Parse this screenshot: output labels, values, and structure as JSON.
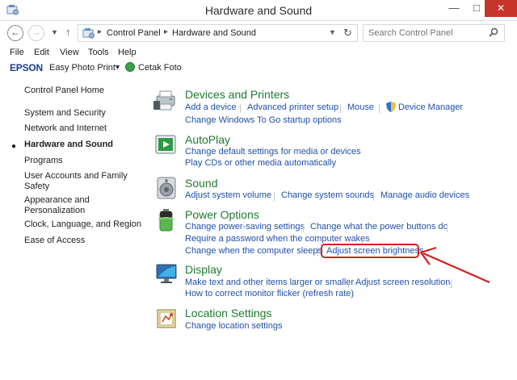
{
  "window": {
    "title": "Hardware and Sound",
    "minimize_glyph": "—",
    "maximize_glyph": "□",
    "close_glyph": "✕"
  },
  "address": {
    "breadcrumb": [
      "Control Panel",
      "Hardware and Sound"
    ],
    "search_placeholder": "Search Control Panel"
  },
  "menubar": {
    "items": [
      "File",
      "Edit",
      "View",
      "Tools",
      "Help"
    ]
  },
  "toolbar": {
    "brand": "EPSON",
    "app_label": "Easy Photo Print",
    "cetak_label": "Cetak Foto"
  },
  "sidebar": {
    "home": "Control Panel Home",
    "items": [
      "System and Security",
      "Network and Internet",
      "Hardware and Sound",
      "Programs",
      "User Accounts and Family",
      "Safety",
      "Appearance and",
      "Personalization",
      "Clock, Language, and Region",
      "Ease of Access"
    ],
    "active": "Hardware and Sound"
  },
  "categories": {
    "devices": {
      "title": "Devices and Printers",
      "links": [
        "Add a device",
        "Advanced printer setup",
        "Mouse",
        "Device Manager",
        "Change Windows To Go startup options"
      ]
    },
    "autoplay": {
      "title": "AutoPlay",
      "links": [
        "Change default settings for media or devices",
        "Play CDs or other media automatically"
      ]
    },
    "sound": {
      "title": "Sound",
      "links": [
        "Adjust system volume",
        "Change system sounds",
        "Manage audio devices"
      ]
    },
    "power": {
      "title": "Power Options",
      "links": [
        "Change power-saving settings",
        "Change what the power buttons do",
        "Require a password when the computer wakes",
        "Change when the computer sleeps",
        "Adjust screen brightness"
      ]
    },
    "display": {
      "title": "Display",
      "links": [
        "Make text and other items larger or smaller",
        "Adjust screen resolution",
        "How to correct monitor flicker (refresh rate)"
      ]
    },
    "location": {
      "title": "Location Settings",
      "links": [
        "Change location settings"
      ]
    }
  },
  "colors": {
    "link": "#1f4fa8",
    "category_title": "#1e7a2e",
    "highlight": "#d11f1f",
    "close_button": "#c7352a"
  },
  "annotations": {
    "highlighted_link": "Adjust screen brightness"
  }
}
